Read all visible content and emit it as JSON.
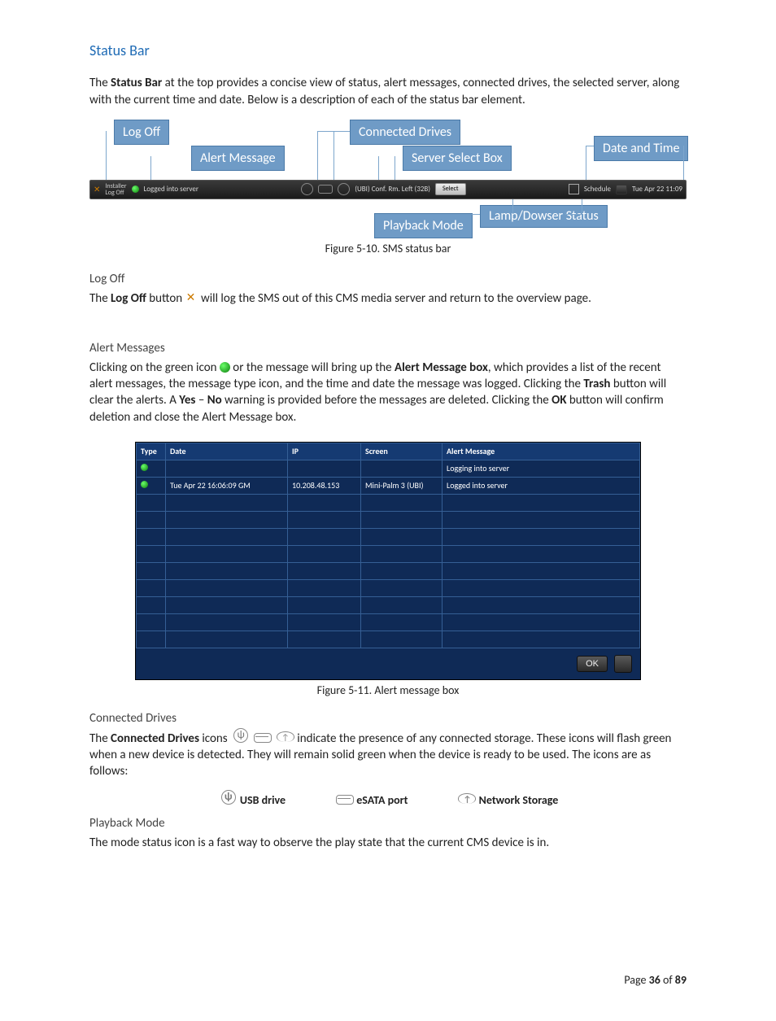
{
  "title": "Status Bar",
  "intro_1a": "The ",
  "intro_1b": "Status Bar",
  "intro_1c": " at the top provides a concise view of status, alert messages, connected drives, the selected server, along with the current time and date.  Below is a description of each of the status bar element.",
  "callouts": {
    "log_off": "Log Off",
    "alert_message": "Alert Message",
    "connected_drives": "Connected Drives",
    "server_select": "Server Select Box",
    "date_time": "Date and Time",
    "playback_mode": "Playback Mode",
    "lamp_dowser": "Lamp/Dowser Status"
  },
  "status_bar": {
    "logoff_label": "Installer\nLog Off",
    "logged_msg": "Logged into server",
    "room": "(UBI) Conf. Rm. Left (32B)",
    "select": "Select",
    "schedule": "Schedule",
    "clock": "Tue Apr 22 11:09"
  },
  "fig10": "Figure 5-10.  SMS status bar",
  "logoff_heading": "Log Off",
  "logoff_a": "The ",
  "logoff_b": "Log Off",
  "logoff_c": " button ",
  "logoff_d": " will log the SMS out of this CMS media server and return to the overview page.",
  "alerts_heading": "Alert Messages",
  "alerts_a": "Clicking on the green icon ",
  "alerts_b": " or the message will bring up the ",
  "alerts_c": "Alert Message box",
  "alerts_d": ", which provides a list of the recent alert messages, the message type icon, and the time and date the message was logged.  Clicking the ",
  "alerts_e": "Trash",
  "alerts_f": " button will clear the alerts.  A ",
  "alerts_g": "Yes",
  "alerts_h": " – ",
  "alerts_i": "No",
  "alerts_j": " warning is provided before the messages are deleted.  Clicking the ",
  "alerts_k": "OK",
  "alerts_l": " button will confirm deletion and close the Alert Message box.",
  "alert_table": {
    "headers": {
      "type": "Type",
      "date": "Date",
      "ip": "IP",
      "screen": "Screen",
      "msg": "Alert Message"
    },
    "rows": [
      {
        "date": "",
        "ip": "",
        "screen": "",
        "msg": "Logging into server"
      },
      {
        "date": "Tue Apr 22 16:06:09 GM",
        "ip": "10.208.48.153",
        "screen": "Mini-Palm 3 (UBI)",
        "msg": "Logged into server"
      }
    ],
    "ok": "OK"
  },
  "fig11": "Figure 5-11.  Alert message box",
  "conn_heading": "Connected Drives",
  "conn_a": "The ",
  "conn_b": "Connected Drives",
  "conn_c": " icons ",
  "conn_d": " indicate the presence of any connected storage.  These icons will flash green when a new device is detected.  They will remain solid green when the device is ready to be used. The icons are as follows:",
  "legend": {
    "usb": "USB drive",
    "esata": "eSATA port",
    "net": "Network Storage"
  },
  "pb_heading": "Playback Mode",
  "pb_text": "The mode status icon is a fast way to observe the play state that the current CMS device is in.",
  "footer": {
    "a": "Page ",
    "b": "36",
    "c": " of ",
    "d": "89"
  }
}
